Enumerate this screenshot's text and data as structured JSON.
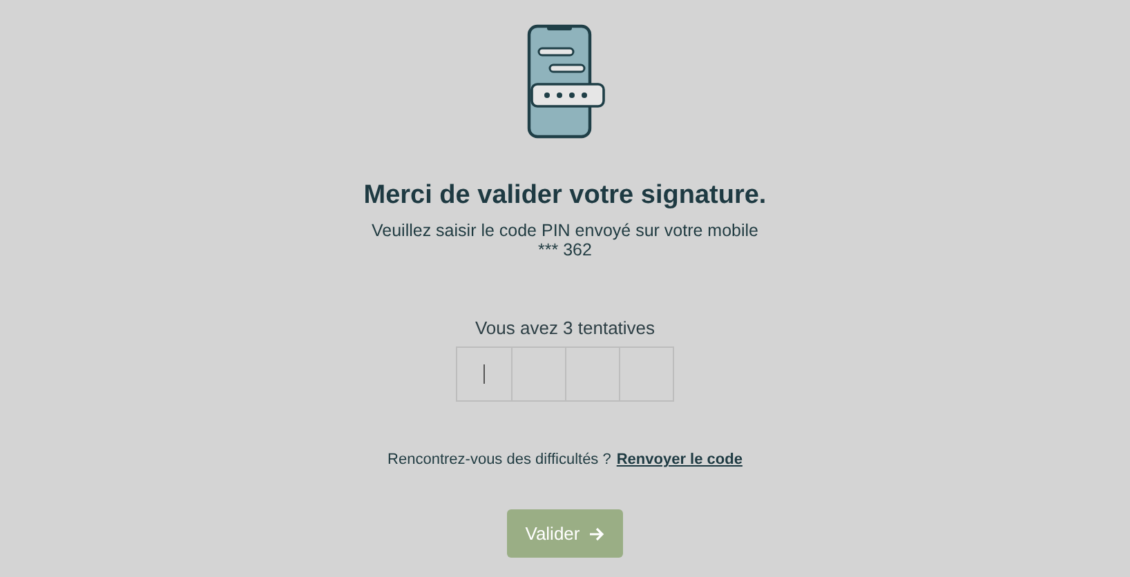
{
  "title": "Merci de valider votre signature.",
  "instruction_lines": [
    "Veuillez saisir le code PIN envoyé sur votre mobile",
    "*** 362"
  ],
  "attempts": "Vous avez 3 tentatives",
  "pin_boxes": [
    {
      "focused": true
    },
    {
      "focused": false
    },
    {
      "focused": false
    },
    {
      "focused": false
    }
  ],
  "help": {
    "text": "Rencontrez-vous des difficultés ?",
    "link": "Renvoyer le code"
  },
  "submit_button": {
    "label": "Valider",
    "disabled": true
  }
}
